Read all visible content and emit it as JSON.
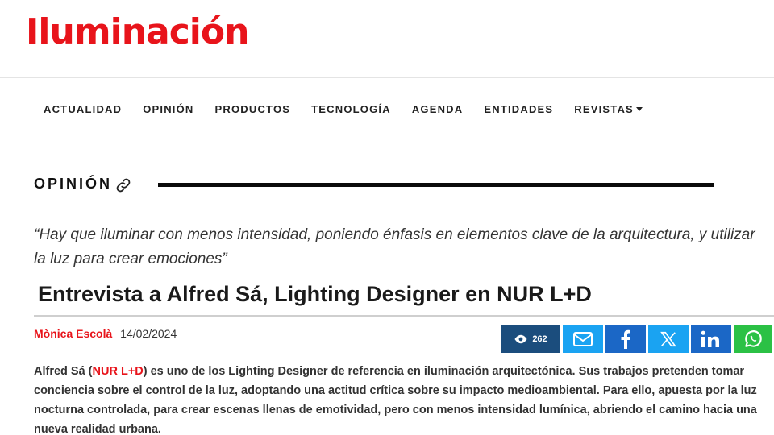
{
  "site": {
    "logo": "Iluminación",
    "brand_color": "#e8141b"
  },
  "nav": {
    "items": [
      {
        "label": "ACTUALIDAD"
      },
      {
        "label": "OPINIÓN"
      },
      {
        "label": "PRODUCTOS"
      },
      {
        "label": "TECNOLOGÍA"
      },
      {
        "label": "AGENDA"
      },
      {
        "label": "ENTIDADES"
      },
      {
        "label": "REVISTAS"
      }
    ]
  },
  "section": {
    "title": "OPINIÓN",
    "icon": "link-icon"
  },
  "article": {
    "quote": "“Hay que iluminar con menos intensidad, poniendo énfasis en elementos clave de la arquitectura, y utilizar la luz para crear emociones”",
    "title": "Entrevista a Alfred Sá, Lighting Designer en NUR L+D",
    "author": "Mònica Escolà",
    "date": "14/02/2024",
    "views": "262",
    "lead": {
      "before": "Alfred Sá (",
      "link": "NUR L+D",
      "after": ") es uno de los Lighting Designer de referencia en iluminación arquitectónica. Sus trabajos pretenden tomar conciencia sobre el control de la luz, adoptando una actitud crítica sobre su impacto medioambiental. Para ello, apuesta por la luz nocturna controlada, para crear escenas llenas de emotividad, pero con menos intensidad lumínica, abriendo el camino hacia una nueva realidad urbana."
    }
  },
  "share": {
    "buttons": [
      {
        "name": "email",
        "icon": "mail-icon",
        "color": "#1aa3f2"
      },
      {
        "name": "facebook",
        "icon": "facebook-icon",
        "color": "#1b67c6"
      },
      {
        "name": "x",
        "icon": "x-icon",
        "color": "#1aa3f2"
      },
      {
        "name": "linkedin",
        "icon": "linkedin-icon",
        "color": "#1b67c6"
      },
      {
        "name": "whatsapp",
        "icon": "whatsapp-icon",
        "color": "#2bc145"
      }
    ],
    "views_color": "#1b4d7d"
  }
}
